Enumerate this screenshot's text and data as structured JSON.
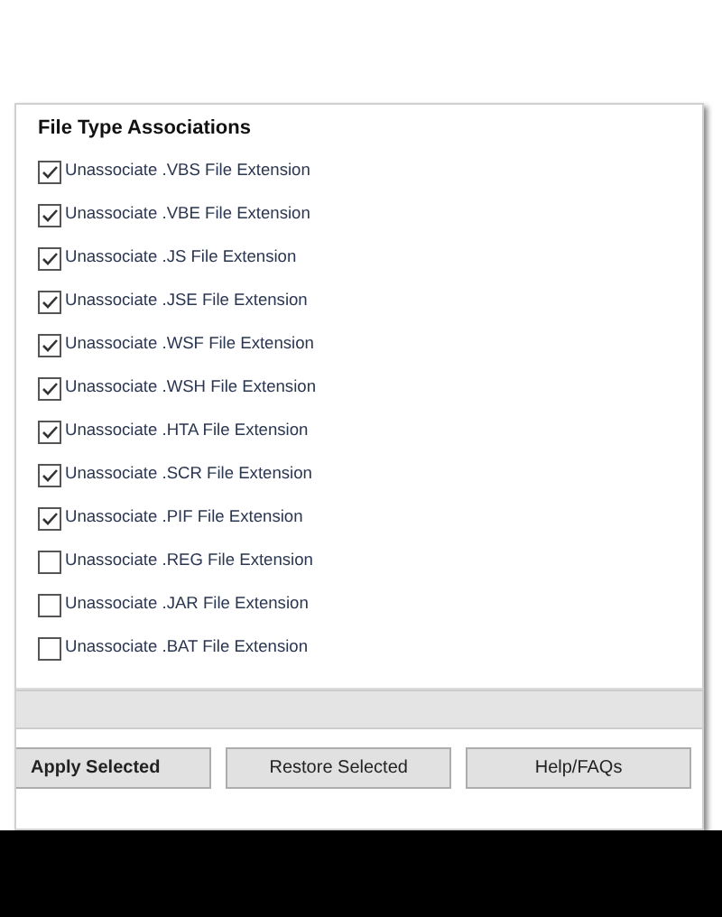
{
  "section": {
    "title": "File Type Associations"
  },
  "options": [
    {
      "label": "Unassociate .VBS File Extension",
      "checked": true
    },
    {
      "label": "Unassociate .VBE File Extension",
      "checked": true
    },
    {
      "label": "Unassociate .JS File Extension",
      "checked": true
    },
    {
      "label": "Unassociate .JSE File Extension",
      "checked": true
    },
    {
      "label": "Unassociate .WSF File Extension",
      "checked": true
    },
    {
      "label": "Unassociate .WSH File Extension",
      "checked": true
    },
    {
      "label": "Unassociate .HTA File Extension",
      "checked": true
    },
    {
      "label": "Unassociate .SCR File Extension",
      "checked": true
    },
    {
      "label": "Unassociate .PIF File Extension",
      "checked": true
    },
    {
      "label": "Unassociate .REG File Extension",
      "checked": false
    },
    {
      "label": "Unassociate .JAR File Extension",
      "checked": false
    },
    {
      "label": "Unassociate .BAT File Extension",
      "checked": false
    }
  ],
  "buttons": [
    {
      "label": "Apply Selected",
      "kind": "primary"
    },
    {
      "label": "Restore Selected",
      "kind": "normal"
    },
    {
      "label": "Help/FAQs",
      "kind": "normal"
    }
  ]
}
